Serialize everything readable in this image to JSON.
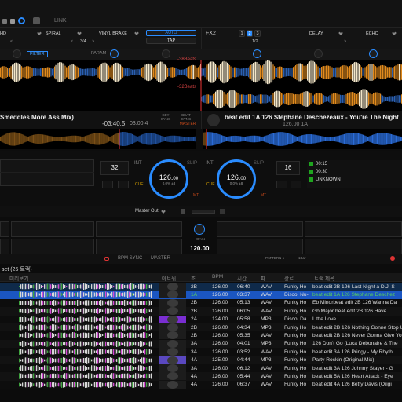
{
  "top": {
    "link": "LINK"
  },
  "fx": {
    "left": {
      "labels": [
        "HD",
        "SPIRAL",
        "VINYL BRAKE"
      ],
      "beat": "3/4",
      "auto": "AUTO",
      "tap": "TAP",
      "filter": "FILTER",
      "param": "PARAM"
    },
    "right": {
      "name": "FX2",
      "nums": [
        "1",
        "2",
        "3"
      ],
      "labels": [
        "DELAY",
        "ECHO"
      ],
      "beat": "1/2"
    }
  },
  "waveform": {
    "beats_top": "-38Beats",
    "beats_bottom": "-32Beats"
  },
  "deck_left": {
    "title": "Smeddles More Ass Mix)",
    "time_remaining": "-03:40.5",
    "time_total": "03:00.4",
    "key_sync": "KEY SYNC",
    "beat_sync": "BEAT SYNC",
    "master": "MASTER",
    "loop": "32",
    "int": "INT",
    "bpm_main": "126.",
    "bpm_dec": "00",
    "bpm_sub": "0.0%  ±8",
    "cue": "CUE",
    "mt": "MT",
    "slip": "SLIP"
  },
  "deck_right": {
    "title": "beat edit 1A 126 Stephane Deschezeaux - You're The Night",
    "bpm_key": "126.00  1A",
    "loop": "16",
    "int": "INT",
    "bpm_main": "126.",
    "bpm_dec": "00",
    "bpm_sub": "0.0%  ±8",
    "cue": "CUE",
    "mt": "MT",
    "slip": "SLIP",
    "cues": [
      "00:15",
      "00:30",
      "UNKNOWN"
    ]
  },
  "mixer": {
    "master_out": "Master Out",
    "gain": "GAIN",
    "bpm": "120.00",
    "bpm_sync": "BPM SYNC",
    "master": "MASTER",
    "pattern": "PATTERN 1",
    "bar": "1Bar"
  },
  "browser": {
    "playlist": "set (25 트랙)",
    "preview": "미리보기",
    "headers": {
      "art": "아트워",
      "key": "조",
      "bpm": "BPM",
      "time": "시간",
      "type": "파",
      "genre": "장르",
      "title": "트랙 제목"
    },
    "rows": [
      {
        "num": "",
        "key": "2B",
        "bpm": "126.00",
        "time": "06:40",
        "type": "WAV",
        "genre": "Funky Ho",
        "title": "beat edit 2B 126 Last Night a D.J. S"
      },
      {
        "num": "",
        "key": "1A",
        "bpm": "126.00",
        "time": "03:37",
        "type": "WAV",
        "genre": "Disco, Nu-",
        "title": "beat edit 1A 126 Stephane Deschez"
      },
      {
        "num": "",
        "key": "2B",
        "bpm": "126.00",
        "time": "05:13",
        "type": "WAV",
        "genre": "Funky Ho",
        "title": "Eb Minorbeat edit 2B 126 Wanna Da"
      },
      {
        "num": "",
        "key": "2B",
        "bpm": "126.00",
        "time": "06:05",
        "type": "WAV",
        "genre": "Funky Ho",
        "title": "Gb Major beat edit 2B 126 Have"
      },
      {
        "num": "",
        "key": "2A",
        "bpm": "124.00",
        "time": "05:58",
        "type": "MP3",
        "genre": "Disco, Da",
        "title": "Little Love"
      },
      {
        "num": "",
        "key": "2B",
        "bpm": "126.00",
        "time": "04:34",
        "type": "MP3",
        "genre": "Funky Ho",
        "title": "beat edit 2B 126  Nothing Gonne Stop Us_(Or"
      },
      {
        "num": "",
        "key": "2B",
        "bpm": "126.00",
        "time": "05:35",
        "type": "WAV",
        "genre": "Funky Ho",
        "title": "beat edit 2B 126 Never Gonna Give You"
      },
      {
        "num": "",
        "key": "3A",
        "bpm": "126.00",
        "time": "04:01",
        "type": "MP3",
        "genre": "Funky Ho",
        "title": "126 Don't Go (Luca Debonaire & The"
      },
      {
        "num": "",
        "key": "3A",
        "bpm": "126.00",
        "time": "03:52",
        "type": "WAV",
        "genre": "Funky Ho",
        "title": "beat edit 3A 126 Pringy - My Rhyth"
      },
      {
        "num": "",
        "key": "4A",
        "bpm": "125.00",
        "time": "04:44",
        "type": "MP3",
        "genre": "Funky Ho",
        "title": "Party Rockin (Original Mix)"
      },
      {
        "num": "",
        "key": "3A",
        "bpm": "126.00",
        "time": "06:12",
        "type": "WAV",
        "genre": "Funky Ho",
        "title": "beat edit 3A 126  Johnny Stayer - G"
      },
      {
        "num": "",
        "key": "4A",
        "bpm": "126.00",
        "time": "05:44",
        "type": "WAV",
        "genre": "Funky Ho",
        "title": "beat edit 5A 126 Heart Attack - Eye"
      },
      {
        "num": "",
        "key": "4A",
        "bpm": "126.00",
        "time": "06:37",
        "type": "WAV",
        "genre": "Funky Ho",
        "title": "beat edit 4A 126 Betty Davis  (Origi"
      }
    ],
    "row_nums": [
      "",
      "",
      "",
      "",
      "",
      "",
      "",
      "",
      "",
      "",
      "",
      "",
      ""
    ]
  },
  "colors": {
    "accent": "#2a8cff",
    "selected": "#1b56c2",
    "highlight": "#0f2a4a",
    "sync": "#c94a1a",
    "text_green": "#59d159"
  }
}
